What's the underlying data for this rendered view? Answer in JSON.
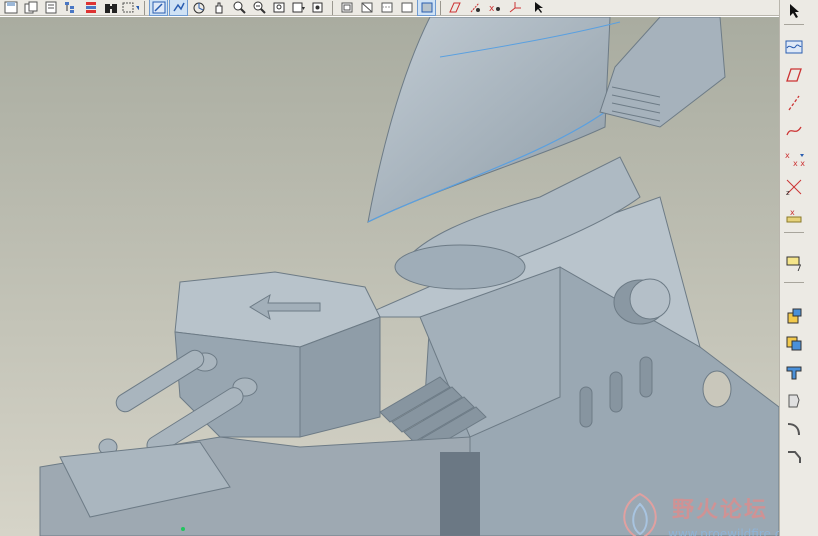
{
  "toolbar": {
    "icons": [
      "save-icon",
      "copy-icon",
      "page-icon",
      "tree-icon",
      "layer-icon",
      "binoculars-icon",
      "view-dropdown-icon",
      "repaint-icon",
      "spin-icon",
      "orient-icon",
      "pan-icon",
      "zoom-in-icon",
      "zoom-out-icon",
      "refit-icon",
      "named-views-icon",
      "saved-views-icon",
      "shading-icon",
      "no-hidden-icon",
      "hidden-line-icon",
      "wireframe-icon",
      "shaded-icon",
      "datum-planes-icon",
      "datum-axes-icon",
      "datum-points-icon",
      "coord-sys-icon",
      "select-arrow-icon"
    ],
    "active_icons": [
      "repaint-icon",
      "spin-icon",
      "shaded-icon"
    ]
  },
  "right_toolbar": {
    "icons": [
      "sketch-wave-icon",
      "datum-plane-icon",
      "datum-axis-icon",
      "datum-curve-icon",
      "datum-point-icon",
      "datum-point-offset-icon",
      "datum-point-field-icon",
      "analysis-feature-icon",
      "extrude-icon",
      "revolve-icon",
      "sweep-icon",
      "blend-icon",
      "round-icon",
      "chamfer-icon"
    ]
  },
  "watermark": {
    "title": "野火论坛",
    "url": "www.proewildfire.cn"
  },
  "colors": {
    "background_top": "#a9aca0",
    "background_bottom": "#d6d4c8",
    "model": "#a8b5bf",
    "edge_highlight": "#5aa0e0"
  }
}
